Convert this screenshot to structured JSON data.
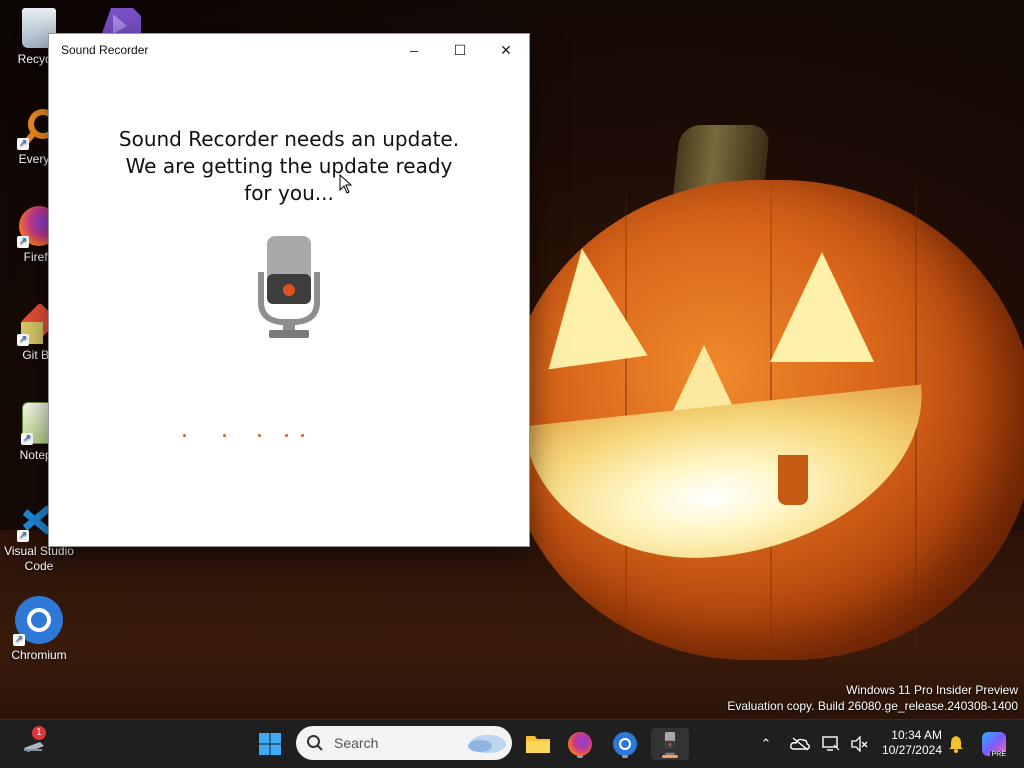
{
  "desktop": {
    "icons": [
      {
        "label": "Recycle"
      },
      {
        "label": ""
      },
      {
        "label": "Everyth"
      },
      {
        "label": "Firefo"
      },
      {
        "label": "Git Ba"
      },
      {
        "label": "Notepa"
      },
      {
        "label": "Visual Studio Code"
      },
      {
        "label": "Chromium"
      }
    ],
    "watermark": {
      "line1": "Windows 11 Pro Insider Preview",
      "line2": "Evaluation copy. Build 26080.ge_release.240308-1400"
    }
  },
  "window": {
    "title": "Sound Recorder",
    "message": "Sound Recorder needs an update. We are getting the update ready for you...",
    "mic_icon": "microphone-icon",
    "accent_color": "#d3641e",
    "controls": {
      "minimize": "–",
      "maximize": "☐",
      "close": "✕"
    }
  },
  "taskbar": {
    "search_placeholder": "Search",
    "notification_count": "1",
    "time": "10:34 AM",
    "date": "10/27/2024",
    "icons": [
      "widgets-icon",
      "start-icon",
      "search-icon",
      "file-explorer-icon",
      "firefox-icon",
      "chromium-icon",
      "sound-recorder-icon",
      "chevron-up-icon",
      "onedrive-icon",
      "network-icon",
      "volume-icon",
      "bell-icon",
      "copilot-icon"
    ]
  }
}
